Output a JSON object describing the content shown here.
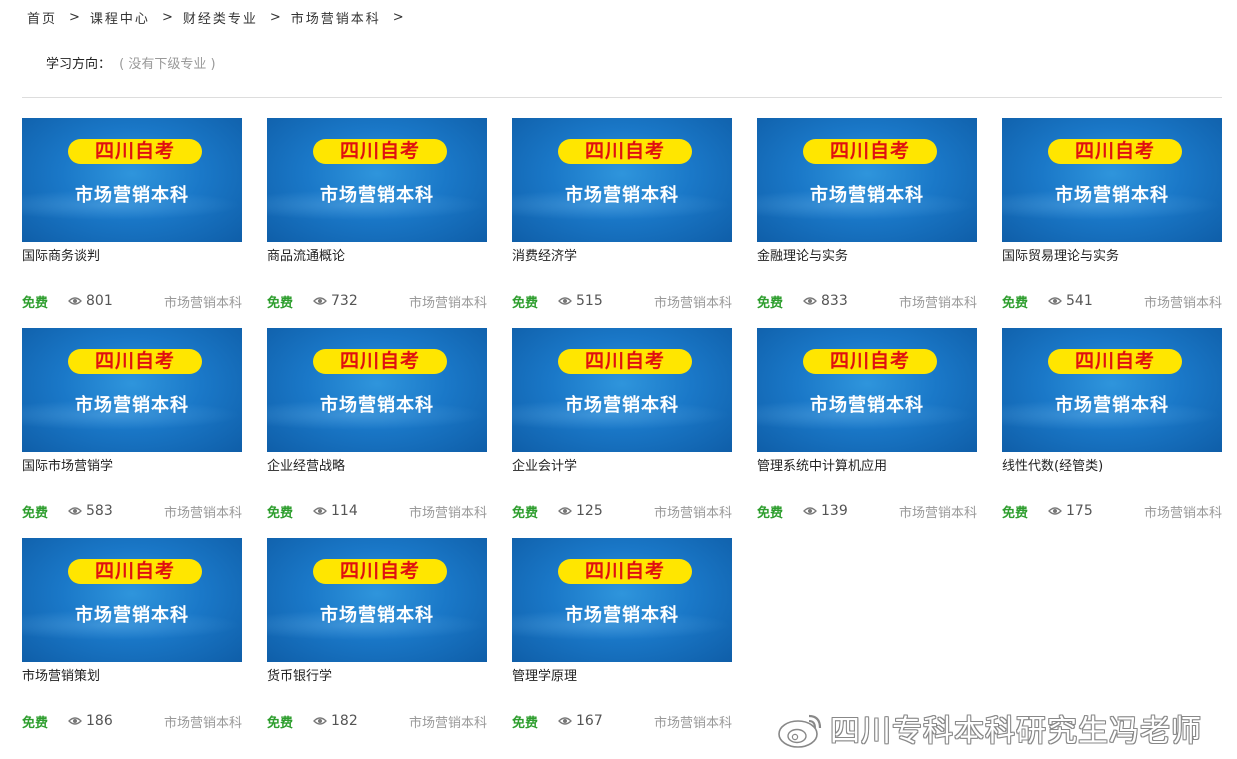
{
  "breadcrumb": {
    "items": [
      "首页",
      "课程中心",
      "财经类专业",
      "市场营销本科"
    ],
    "separator": ">"
  },
  "direction": {
    "label": "学习方向：",
    "value": "( 没有下级专业 )"
  },
  "thumbnail": {
    "badge": "四川自考",
    "subtitle": "市场营销本科"
  },
  "courses": [
    {
      "title": "国际商务谈判",
      "price": "免费",
      "views": "801",
      "category": "市场营销本科"
    },
    {
      "title": "商品流通概论",
      "price": "免费",
      "views": "732",
      "category": "市场营销本科"
    },
    {
      "title": "消费经济学",
      "price": "免费",
      "views": "515",
      "category": "市场营销本科"
    },
    {
      "title": "金融理论与实务",
      "price": "免费",
      "views": "833",
      "category": "市场营销本科"
    },
    {
      "title": "国际贸易理论与实务",
      "price": "免费",
      "views": "541",
      "category": "市场营销本科"
    },
    {
      "title": "国际市场营销学",
      "price": "免费",
      "views": "583",
      "category": "市场营销本科"
    },
    {
      "title": "企业经营战略",
      "price": "免费",
      "views": "114",
      "category": "市场营销本科"
    },
    {
      "title": "企业会计学",
      "price": "免费",
      "views": "125",
      "category": "市场营销本科"
    },
    {
      "title": "管理系统中计算机应用",
      "price": "免费",
      "views": "139",
      "category": "市场营销本科"
    },
    {
      "title": "线性代数(经管类)",
      "price": "免费",
      "views": "175",
      "category": "市场营销本科"
    },
    {
      "title": "市场营销策划",
      "price": "免费",
      "views": "186",
      "category": "市场营销本科"
    },
    {
      "title": "货币银行学",
      "price": "免费",
      "views": "182",
      "category": "市场营销本科"
    },
    {
      "title": "管理学原理",
      "price": "免费",
      "views": "167",
      "category": "市场营销本科"
    }
  ],
  "watermark": {
    "text": "四川专科本科研究生冯老师",
    "icon": "weibo-icon"
  },
  "colors": {
    "free": "#2e9e2e",
    "badge_bg": "#ffe600",
    "badge_text": "#e01010",
    "thumb_blue": "#1a78c8"
  }
}
